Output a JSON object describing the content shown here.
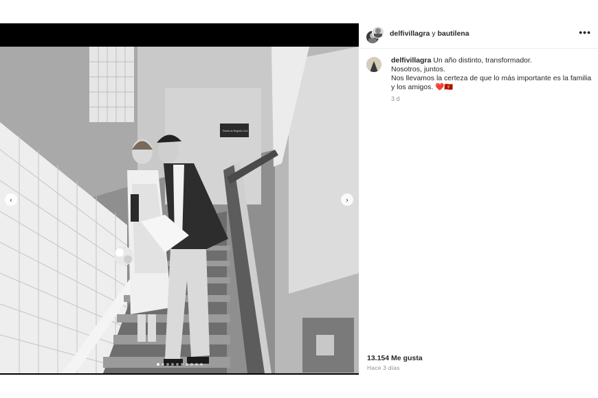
{
  "header": {
    "user1": "delfivillagra",
    "connector": "y",
    "user2": "bautilena",
    "more_icon": "more-horizontal-icon",
    "more_label": "•••"
  },
  "caption": {
    "username": "delfivillagra",
    "line1": "Un año distinto, transformador.",
    "line2": "Nosotros, juntos.",
    "line3": "Nos llevamos la certeza de que lo más importante es la familia y los amigos. ❤️🇲🇪",
    "time": "3 d"
  },
  "footer": {
    "likes": "13.154 Me gusta",
    "ago": "Hace 3 días"
  },
  "carousel": {
    "prev_icon": "chevron-left-icon",
    "prev_label": "‹",
    "next_icon": "chevron-right-icon",
    "next_label": "›",
    "slide_count": 10,
    "active_slide": 1
  },
  "photo": {
    "sign_text": "Planta de Registro Civil"
  }
}
